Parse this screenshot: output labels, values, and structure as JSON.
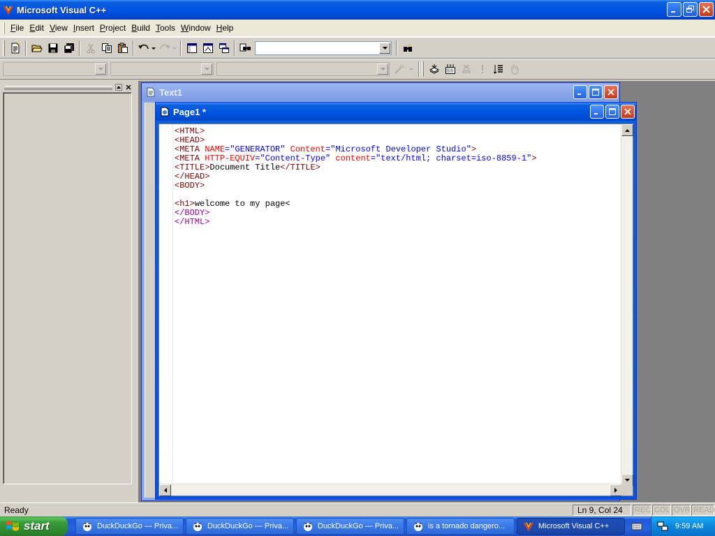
{
  "window": {
    "title": "Microsoft Visual C++"
  },
  "menu": [
    "File",
    "Edit",
    "View",
    "Insert",
    "Project",
    "Build",
    "Tools",
    "Window",
    "Help"
  ],
  "toolbar": {
    "find_combo_value": "",
    "icons": [
      "new-text-file",
      "open",
      "save",
      "save-all",
      "cut",
      "copy",
      "paste",
      "undo",
      "redo",
      "workspace",
      "output",
      "window-list",
      "find-in-files",
      "find"
    ]
  },
  "wizardbar": {
    "class_combo_value": "",
    "filter_combo_value": "",
    "members_combo_value": "",
    "icons": [
      "wizard-action",
      "compile",
      "build",
      "stop-build",
      "execute",
      "insert-breakpoint",
      "go"
    ]
  },
  "mdi": {
    "back_window_title": "Text1",
    "front_window_title": "Page1 *"
  },
  "editor": {
    "lines": [
      [
        {
          "t": "<HTML>",
          "c": "tag"
        }
      ],
      [
        {
          "t": "<HEAD>",
          "c": "tag"
        }
      ],
      [
        {
          "t": "<META ",
          "c": "tag"
        },
        {
          "t": "NAME",
          "c": "attr"
        },
        {
          "t": "=\"GENERATOR\" ",
          "c": "val"
        },
        {
          "t": "Content",
          "c": "attr"
        },
        {
          "t": "=\"Microsoft Developer Studio\"",
          "c": "val"
        },
        {
          "t": ">",
          "c": "tag"
        }
      ],
      [
        {
          "t": "<META ",
          "c": "tag"
        },
        {
          "t": "HTTP-EQUIV",
          "c": "attr"
        },
        {
          "t": "=\"Content-Type\" ",
          "c": "val"
        },
        {
          "t": "content",
          "c": "attr"
        },
        {
          "t": "=\"text/html; charset=iso-8859-1\"",
          "c": "val"
        },
        {
          "t": ">",
          "c": "tag"
        }
      ],
      [
        {
          "t": "<TITLE>",
          "c": "tag"
        },
        {
          "t": "Document Title",
          "c": "text"
        },
        {
          "t": "</TITLE>",
          "c": "tag"
        }
      ],
      [
        {
          "t": "</HEAD>",
          "c": "tag"
        }
      ],
      [
        {
          "t": "<BODY>",
          "c": "tag"
        }
      ],
      [
        {
          "t": "",
          "c": "text"
        }
      ],
      [
        {
          "t": "<h1>",
          "c": "tag"
        },
        {
          "t": "welcome to my page<",
          "c": "text"
        }
      ],
      [
        {
          "t": "</BODY>",
          "c": "purple"
        }
      ],
      [
        {
          "t": "</HTML>",
          "c": "purple"
        }
      ]
    ]
  },
  "status": {
    "message": "Ready",
    "position": "Ln 9, Col 24",
    "indicators": [
      "REC",
      "COL",
      "OVR",
      "READ"
    ]
  },
  "taskbar": {
    "start_label": "start",
    "tasks": [
      {
        "label": "DuckDuckGo — Priva...",
        "icon": "browser-icon"
      },
      {
        "label": "DuckDuckGo — Priva...",
        "icon": "browser-icon"
      },
      {
        "label": "DuckDuckGo — Priva...",
        "icon": "browser-icon"
      },
      {
        "label": "is a tornado dangero...",
        "icon": "browser-icon"
      },
      {
        "label": "Microsoft Visual C++",
        "icon": "vc-icon"
      }
    ],
    "clock": "9:59 AM"
  },
  "colors": {
    "xp_blue": "#0054e3",
    "start_green": "#3a9b3a",
    "code_tag": "#800000",
    "code_attr": "#ff0000",
    "code_value": "#0000ff"
  }
}
